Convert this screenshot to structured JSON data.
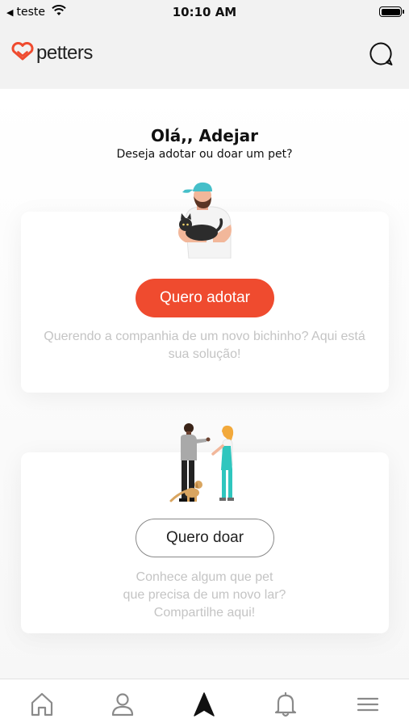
{
  "status_bar": {
    "back_arrow": "◀",
    "carrier": "teste",
    "time": "10:10 AM",
    "icons": [
      "wifi-icon",
      "battery-icon"
    ]
  },
  "header": {
    "logo_text": "petters",
    "logo_icon": "heart-logo-icon",
    "chat_icon": "chat-bubble-icon"
  },
  "greeting": {
    "title": "Olá,, Adejar",
    "subtitle": "Deseja adotar ou doar um pet?"
  },
  "adopt_card": {
    "illustration": "man-holding-cat",
    "button_label": "Quero adotar",
    "description_lines": [
      "Querendo a companhia de um novo bichinho? Aqui está",
      "sua solução!"
    ]
  },
  "donate_card": {
    "illustration": "people-with-dog",
    "button_label": "Quero doar",
    "description_lines": [
      "Conhece algum que pet",
      "que precisa de um novo lar?",
      "Compartilhe aqui!"
    ]
  },
  "tab_bar": {
    "items": [
      {
        "icon": "home-icon",
        "active": false
      },
      {
        "icon": "profile-icon",
        "active": false
      },
      {
        "icon": "navigation-arrow-icon",
        "active": true
      },
      {
        "icon": "bell-icon",
        "active": false
      },
      {
        "icon": "menu-icon",
        "active": false
      }
    ]
  },
  "colors": {
    "accent": "#ef4b2f",
    "background": "#f2f2f2",
    "muted_text": "#c4c4c4",
    "icon_gray": "#8a8a8a"
  }
}
